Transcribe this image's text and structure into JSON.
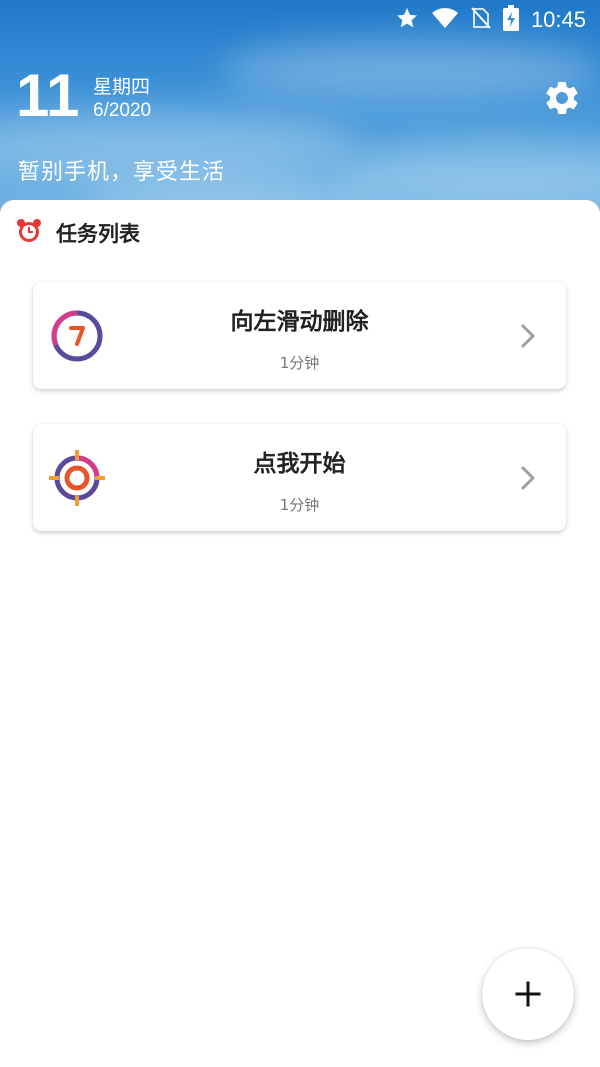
{
  "status_bar": {
    "time": "10:45",
    "icons": [
      "star-icon",
      "wifi-icon",
      "no-sim-icon",
      "battery-charging-icon"
    ]
  },
  "header": {
    "day": "11",
    "weekday": "星期四",
    "month_year": "6/2020",
    "slogan": "暂别手机，享受生活",
    "settings_icon": "gear-icon"
  },
  "task_list": {
    "icon": "alarm-clock-icon",
    "title": "任务列表",
    "items": [
      {
        "title": "向左滑动删除",
        "duration": "1分钟",
        "icon": "clock-icon"
      },
      {
        "title": "点我开始",
        "duration": "1分钟",
        "icon": "target-icon"
      }
    ]
  },
  "fab": {
    "icon": "plus-icon"
  },
  "colors": {
    "header_blue": "#2f86d0",
    "alarm_red": "#e53935",
    "icon_purple": "#5b4a9b",
    "icon_pink": "#d43c8a",
    "icon_orange": "#f0a030"
  }
}
